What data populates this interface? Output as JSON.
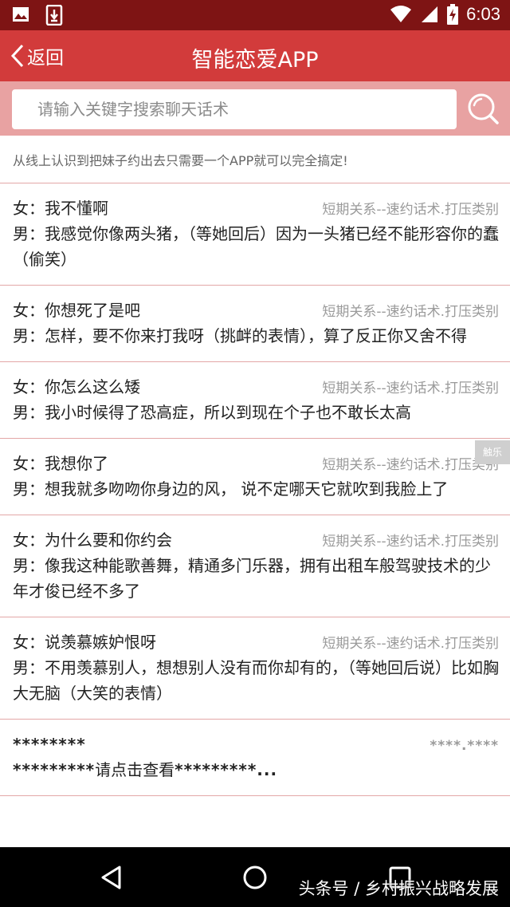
{
  "status_bar": {
    "time": "6:03"
  },
  "app_bar": {
    "back_label": "返回",
    "title": "智能恋爱APP"
  },
  "search": {
    "placeholder": "请输入关键字搜索聊天话术",
    "value": ""
  },
  "tagline": "从线上认识到把妹子约出去只需要一个APP就可以完全搞定!",
  "items": [
    {
      "female": "女：我不懂啊",
      "category": "短期关系--速约话术.打压类别",
      "male": "男：我感觉你像两头猪，（等她回后）因为一头猪已经不能形容你的蠢（偷笑）"
    },
    {
      "female": "女：你想死了是吧",
      "category": "短期关系--速约话术.打压类别",
      "male": "男：怎样，要不你来打我呀（挑衅的表情），算了反正你又舍不得"
    },
    {
      "female": "女：你怎么这么矮",
      "category": "短期关系--速约话术.打压类别",
      "male": "男：我小时候得了恐高症，所以到现在个子也不敢长太高"
    },
    {
      "female": "女：我想你了",
      "category": "短期关系--速约话术.打压类别",
      "male": "男：想我就多吻吻你身边的风， 说不定哪天它就吹到我脸上了"
    },
    {
      "female": "女：为什么要和你约会",
      "category": "短期关系--速约话术.打压类别",
      "male": "男：像我这种能歌善舞，精通多门乐器，拥有出租车般驾驶技术的少年才俊已经不多了"
    },
    {
      "female": "女：说羡慕嫉妒恨呀",
      "category": "短期关系--速约话术.打压类别",
      "male": "男：不用羡慕别人，想想别人没有而你却有的，（等她回后说）比如胸大无脑（大笑的表情）"
    }
  ],
  "locked_item": {
    "title": "********",
    "category": "****.****",
    "stars_before": "*********",
    "prompt": "请点击查看",
    "stars_after": "*********..."
  },
  "side_badge": "触乐",
  "watermark": "头条号 / 乡村振兴战略发展"
}
